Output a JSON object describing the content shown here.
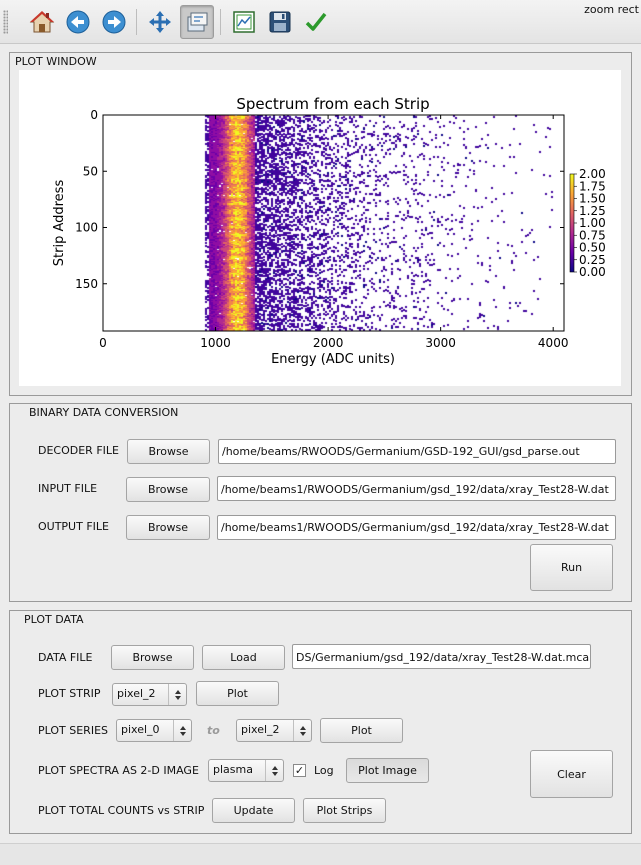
{
  "toolbar": {
    "message": "zoom rect",
    "buttons": [
      {
        "icon": "home-icon"
      },
      {
        "icon": "arrow-left-icon"
      },
      {
        "icon": "arrow-right-icon"
      },
      {
        "icon": "pan-move-icon"
      },
      {
        "icon": "zoom-rect-icon",
        "active": true
      },
      {
        "icon": "subplots-config-icon"
      },
      {
        "icon": "save-disk-icon"
      },
      {
        "icon": "checkmark-icon"
      }
    ]
  },
  "plot_window": {
    "title": "PLOT WINDOW"
  },
  "chart_data": {
    "type": "heatmap",
    "title": "Spectrum from each Strip",
    "xlabel": "Energy (ADC units)",
    "ylabel": "Strip Address",
    "x_ticks": [
      "0",
      "1000",
      "2000",
      "3000",
      "4000"
    ],
    "y_ticks": [
      "0",
      "50",
      "100",
      "150"
    ],
    "xlim": [
      0,
      4096
    ],
    "ylim": [
      192,
      0
    ],
    "colormap": "plasma",
    "colorbar_ticks": [
      "2.00",
      "1.75",
      "1.50",
      "1.25",
      "1.00",
      "0.75",
      "0.50",
      "0.25",
      "0.00"
    ],
    "colorbar_range": [
      0,
      2
    ],
    "log_scale": true,
    "band": {
      "peak_energy": 1190,
      "band_start": 930,
      "band_end": 1350,
      "tail_end": 4000
    }
  },
  "binary_conversion": {
    "title": "BINARY DATA CONVERSION",
    "decoder": {
      "label": "DECODER FILE",
      "browse": "Browse",
      "path": "/home/beams/RWOODS/Germanium/GSD-192_GUI/gsd_parse.out"
    },
    "input": {
      "label": "INPUT FILE",
      "browse": "Browse",
      "path": "/home/beams1/RWOODS/Germanium/gsd_192/data/xray_Test28-W.dat"
    },
    "output": {
      "label": "OUTPUT FILE",
      "browse": "Browse",
      "path": "/home/beams1/RWOODS/Germanium/gsd_192/data/xray_Test28-W.dat"
    },
    "run": "Run"
  },
  "plot_data": {
    "title": "PLOT DATA",
    "data_file": {
      "label": "DATA FILE",
      "browse": "Browse",
      "load": "Load",
      "path": "DS/Germanium/gsd_192/data/xray_Test28-W.dat.mca"
    },
    "plot_strip": {
      "label": "PLOT STRIP",
      "selected": "pixel_2",
      "plot": "Plot"
    },
    "plot_series": {
      "label": "PLOT SERIES",
      "from": "pixel_0",
      "to_label": "to",
      "to": "pixel_2",
      "plot": "Plot"
    },
    "spectra_image": {
      "label": "PLOT SPECTRA AS 2-D IMAGE",
      "colormap": "plasma",
      "log_label": "Log",
      "log_checked": "✓",
      "plot_image": "Plot Image"
    },
    "total_counts": {
      "label": "PLOT TOTAL COUNTS vs STRIP",
      "update": "Update",
      "plot_strips": "Plot Strips"
    },
    "clear": "Clear"
  }
}
